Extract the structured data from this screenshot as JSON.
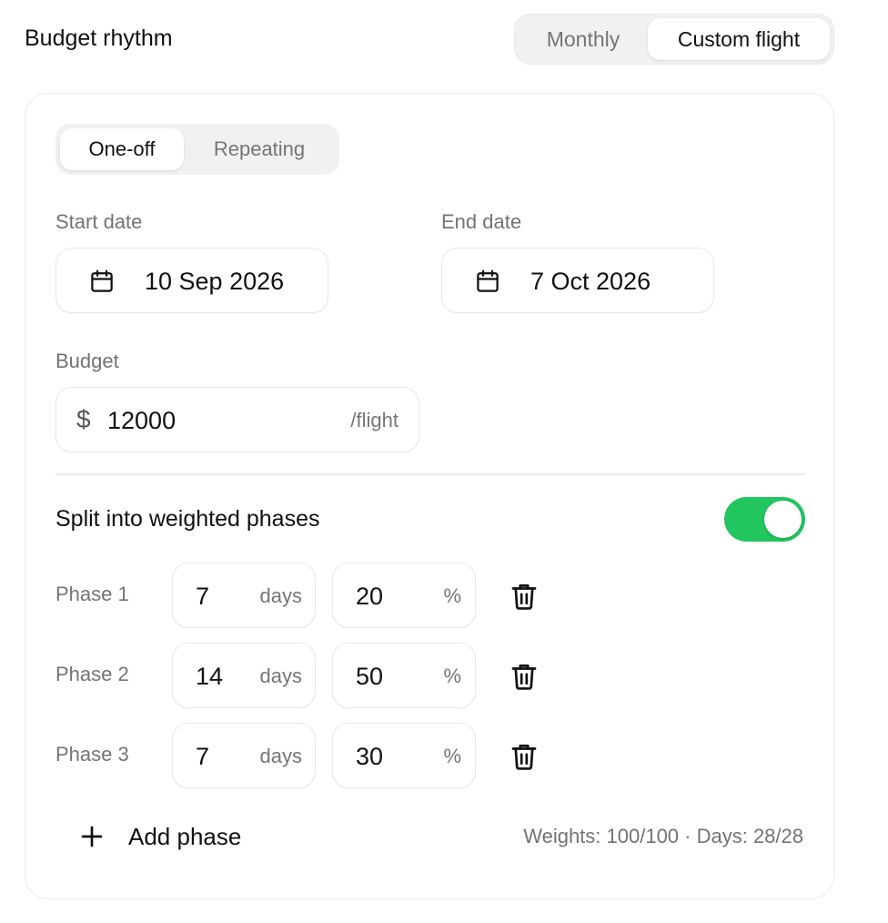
{
  "header": {
    "title": "Budget rhythm",
    "rhythm_options": [
      "Monthly",
      "Custom flight"
    ],
    "rhythm_selected": "Custom flight"
  },
  "card": {
    "schedule_options": [
      "One-off",
      "Repeating"
    ],
    "schedule_selected": "One-off",
    "start_date": {
      "label": "Start date",
      "value": "10 Sep 2026",
      "icon": "calendar-icon"
    },
    "end_date": {
      "label": "End date",
      "value": "7 Oct 2026",
      "icon": "calendar-icon"
    },
    "budget": {
      "label": "Budget",
      "currency": "$",
      "value": "12000",
      "suffix": "/flight"
    },
    "split": {
      "label": "Split into weighted phases",
      "enabled": true,
      "toggle_color": "#22c55e"
    },
    "phases": [
      {
        "name": "Phase 1",
        "days": "7",
        "days_unit": "days",
        "weight": "20",
        "weight_unit": "%"
      },
      {
        "name": "Phase 2",
        "days": "14",
        "days_unit": "days",
        "weight": "50",
        "weight_unit": "%"
      },
      {
        "name": "Phase 3",
        "days": "7",
        "days_unit": "days",
        "weight": "30",
        "weight_unit": "%"
      }
    ],
    "add_phase_label": "Add phase",
    "summary": "Weights: 100/100 · Days: 28/28"
  }
}
